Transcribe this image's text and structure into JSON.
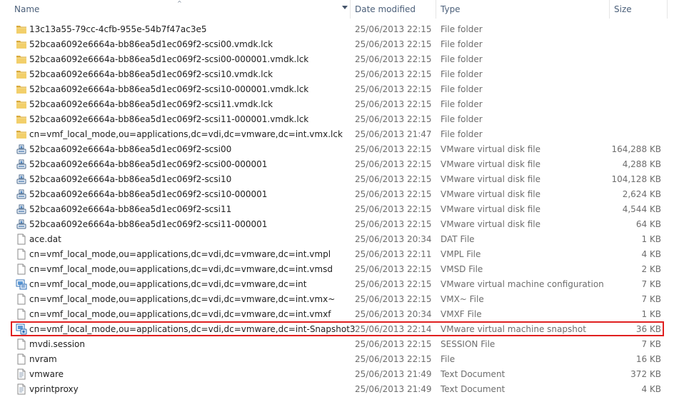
{
  "header": {
    "name": "Name",
    "date_modified": "Date modified",
    "type": "Type",
    "size": "Size",
    "sort_glyph": "^"
  },
  "rows": [
    {
      "name": "13c13a55-79cc-4cfb-955e-54b7f47ac3e5",
      "date": "25/06/2013 22:15",
      "type": "File folder",
      "size": "",
      "icon": "folder-icon"
    },
    {
      "name": "52bcaa6092e6664a-bb86ea5d1ec069f2-scsi00.vmdk.lck",
      "date": "25/06/2013 22:15",
      "type": "File folder",
      "size": "",
      "icon": "folder-icon"
    },
    {
      "name": "52bcaa6092e6664a-bb86ea5d1ec069f2-scsi00-000001.vmdk.lck",
      "date": "25/06/2013 22:15",
      "type": "File folder",
      "size": "",
      "icon": "folder-icon"
    },
    {
      "name": "52bcaa6092e6664a-bb86ea5d1ec069f2-scsi10.vmdk.lck",
      "date": "25/06/2013 22:15",
      "type": "File folder",
      "size": "",
      "icon": "folder-icon"
    },
    {
      "name": "52bcaa6092e6664a-bb86ea5d1ec069f2-scsi10-000001.vmdk.lck",
      "date": "25/06/2013 22:15",
      "type": "File folder",
      "size": "",
      "icon": "folder-icon"
    },
    {
      "name": "52bcaa6092e6664a-bb86ea5d1ec069f2-scsi11.vmdk.lck",
      "date": "25/06/2013 22:15",
      "type": "File folder",
      "size": "",
      "icon": "folder-icon"
    },
    {
      "name": "52bcaa6092e6664a-bb86ea5d1ec069f2-scsi11-000001.vmdk.lck",
      "date": "25/06/2013 22:15",
      "type": "File folder",
      "size": "",
      "icon": "folder-icon"
    },
    {
      "name": "cn=vmf_local_mode,ou=applications,dc=vdi,dc=vmware,dc=int.vmx.lck",
      "date": "25/06/2013 21:47",
      "type": "File folder",
      "size": "",
      "icon": "folder-icon"
    },
    {
      "name": "52bcaa6092e6664a-bb86ea5d1ec069f2-scsi00",
      "date": "25/06/2013 22:15",
      "type": "VMware virtual disk file",
      "size": "164,288 KB",
      "icon": "virtual-disk-icon"
    },
    {
      "name": "52bcaa6092e6664a-bb86ea5d1ec069f2-scsi00-000001",
      "date": "25/06/2013 22:15",
      "type": "VMware virtual disk file",
      "size": "4,288 KB",
      "icon": "virtual-disk-icon"
    },
    {
      "name": "52bcaa6092e6664a-bb86ea5d1ec069f2-scsi10",
      "date": "25/06/2013 22:15",
      "type": "VMware virtual disk file",
      "size": "104,128 KB",
      "icon": "virtual-disk-icon"
    },
    {
      "name": "52bcaa6092e6664a-bb86ea5d1ec069f2-scsi10-000001",
      "date": "25/06/2013 22:15",
      "type": "VMware virtual disk file",
      "size": "2,624 KB",
      "icon": "virtual-disk-icon"
    },
    {
      "name": "52bcaa6092e6664a-bb86ea5d1ec069f2-scsi11",
      "date": "25/06/2013 22:15",
      "type": "VMware virtual disk file",
      "size": "4,544 KB",
      "icon": "virtual-disk-icon"
    },
    {
      "name": "52bcaa6092e6664a-bb86ea5d1ec069f2-scsi11-000001",
      "date": "25/06/2013 22:15",
      "type": "VMware virtual disk file",
      "size": "64 KB",
      "icon": "virtual-disk-icon"
    },
    {
      "name": "ace.dat",
      "date": "25/06/2013 20:34",
      "type": "DAT File",
      "size": "1 KB",
      "icon": "file-icon"
    },
    {
      "name": "cn=vmf_local_mode,ou=applications,dc=vdi,dc=vmware,dc=int.vmpl",
      "date": "25/06/2013 22:11",
      "type": "VMPL File",
      "size": "4 KB",
      "icon": "file-icon"
    },
    {
      "name": "cn=vmf_local_mode,ou=applications,dc=vdi,dc=vmware,dc=int.vmsd",
      "date": "25/06/2013 22:15",
      "type": "VMSD File",
      "size": "2 KB",
      "icon": "file-icon"
    },
    {
      "name": "cn=vmf_local_mode,ou=applications,dc=vdi,dc=vmware,dc=int",
      "date": "25/06/2013 22:15",
      "type": "VMware virtual machine configuration",
      "size": "7 KB",
      "icon": "vm-config-icon"
    },
    {
      "name": "cn=vmf_local_mode,ou=applications,dc=vdi,dc=vmware,dc=int.vmx~",
      "date": "25/06/2013 22:15",
      "type": "VMX~ File",
      "size": "7 KB",
      "icon": "file-icon"
    },
    {
      "name": "cn=vmf_local_mode,ou=applications,dc=vdi,dc=vmware,dc=int.vmxf",
      "date": "25/06/2013 20:34",
      "type": "VMXF File",
      "size": "1 KB",
      "icon": "file-icon"
    },
    {
      "name": "cn=vmf_local_mode,ou=applications,dc=vdi,dc=vmware,dc=int-Snapshot3",
      "date": "25/06/2013 22:14",
      "type": "VMware virtual machine snapshot",
      "size": "36 KB",
      "icon": "vm-snapshot-icon"
    },
    {
      "name": "mvdi.session",
      "date": "25/06/2013 22:15",
      "type": "SESSION File",
      "size": "7 KB",
      "icon": "file-icon"
    },
    {
      "name": "nvram",
      "date": "25/06/2013 22:15",
      "type": "File",
      "size": "16 KB",
      "icon": "file-icon"
    },
    {
      "name": "vmware",
      "date": "25/06/2013 21:49",
      "type": "Text Document",
      "size": "372 KB",
      "icon": "text-document-icon"
    },
    {
      "name": "vprintproxy",
      "date": "25/06/2013 21:49",
      "type": "Text Document",
      "size": "4 KB",
      "icon": "text-document-icon"
    }
  ],
  "colors": {
    "header_text": "#4c607a",
    "highlight_border": "#e02020",
    "folder": "#e8c15a"
  }
}
